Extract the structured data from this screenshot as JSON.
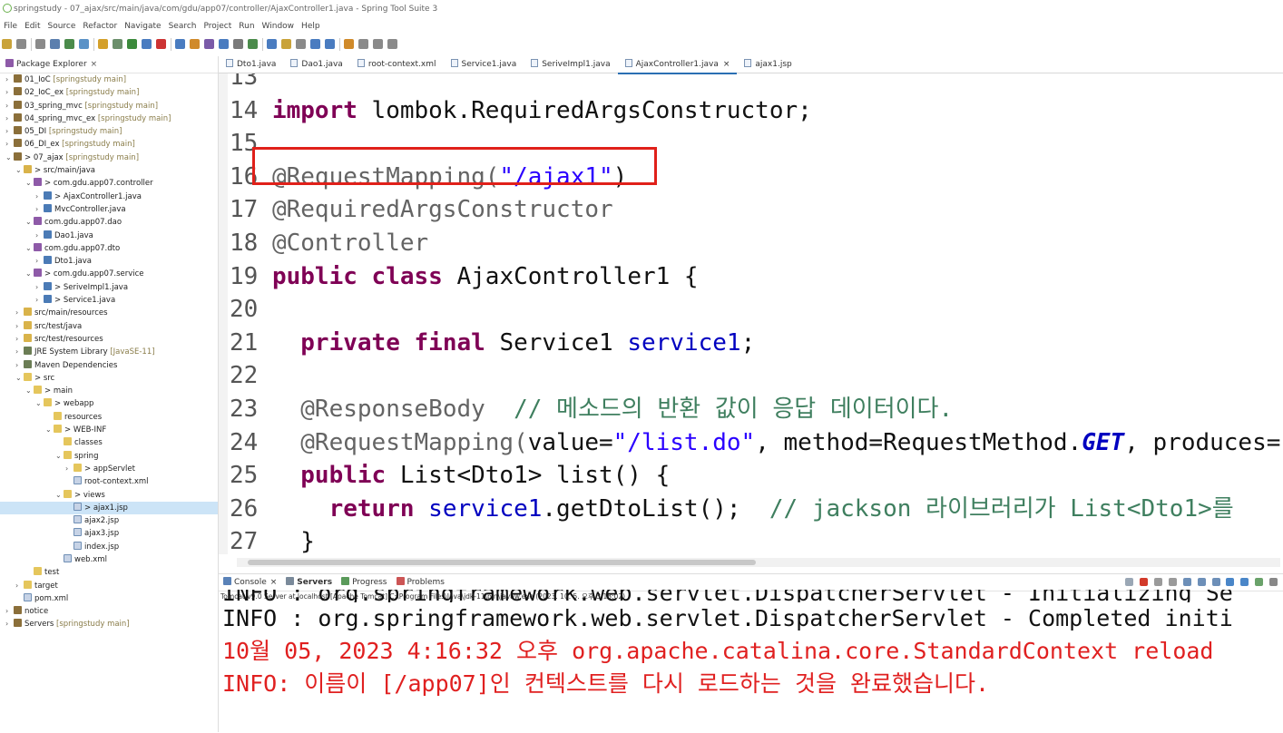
{
  "window": {
    "title": "springstudy - 07_ajax/src/main/java/com/gdu/app07/controller/AjaxController1.java - Spring Tool Suite 3"
  },
  "menu": [
    "File",
    "Edit",
    "Source",
    "Refactor",
    "Navigate",
    "Search",
    "Project",
    "Run",
    "Window",
    "Help"
  ],
  "explorer": {
    "title": "Package Explorer",
    "close": "×",
    "nodes": [
      {
        "label": "01_IoC",
        "deco": " [springstudy main]",
        "arrow": "›",
        "icon": "proj",
        "indent": 0
      },
      {
        "label": "02_IoC_ex",
        "deco": " [springstudy main]",
        "arrow": "›",
        "icon": "proj",
        "indent": 0
      },
      {
        "label": "03_spring_mvc",
        "deco": " [springstudy main]",
        "arrow": "›",
        "icon": "proj",
        "indent": 0
      },
      {
        "label": "04_spring_mvc_ex",
        "deco": " [springstudy main]",
        "arrow": "›",
        "icon": "proj",
        "indent": 0
      },
      {
        "label": "05_DI",
        "deco": " [springstudy main]",
        "arrow": "›",
        "icon": "proj",
        "indent": 0
      },
      {
        "label": "06_DI_ex",
        "deco": " [springstudy main]",
        "arrow": "›",
        "icon": "proj",
        "indent": 0
      },
      {
        "label": "> 07_ajax",
        "deco": " [springstudy main]",
        "arrow": "⌄",
        "icon": "proj",
        "indent": 0
      },
      {
        "label": "> src/main/java",
        "deco": "",
        "arrow": "⌄",
        "icon": "srcf",
        "indent": 1
      },
      {
        "label": "> com.gdu.app07.controller",
        "deco": "",
        "arrow": "⌄",
        "icon": "pkg",
        "indent": 2
      },
      {
        "label": "> AjaxController1.java",
        "deco": "",
        "arrow": "›",
        "icon": "java",
        "indent": 3
      },
      {
        "label": "MvcController.java",
        "deco": "",
        "arrow": "›",
        "icon": "java",
        "indent": 3
      },
      {
        "label": "com.gdu.app07.dao",
        "deco": "",
        "arrow": "⌄",
        "icon": "pkg",
        "indent": 2
      },
      {
        "label": "Dao1.java",
        "deco": "",
        "arrow": "›",
        "icon": "java",
        "indent": 3
      },
      {
        "label": "com.gdu.app07.dto",
        "deco": "",
        "arrow": "⌄",
        "icon": "pkg",
        "indent": 2
      },
      {
        "label": "Dto1.java",
        "deco": "",
        "arrow": "›",
        "icon": "java",
        "indent": 3
      },
      {
        "label": "> com.gdu.app07.service",
        "deco": "",
        "arrow": "⌄",
        "icon": "pkg",
        "indent": 2
      },
      {
        "label": "> SeriveImpl1.java",
        "deco": "",
        "arrow": "›",
        "icon": "java",
        "indent": 3
      },
      {
        "label": "> Service1.java",
        "deco": "",
        "arrow": "›",
        "icon": "java",
        "indent": 3
      },
      {
        "label": "src/main/resources",
        "deco": "",
        "arrow": "›",
        "icon": "srcf",
        "indent": 1
      },
      {
        "label": "src/test/java",
        "deco": "",
        "arrow": "›",
        "icon": "srcf",
        "indent": 1
      },
      {
        "label": "src/test/resources",
        "deco": "",
        "arrow": "›",
        "icon": "srcf",
        "indent": 1
      },
      {
        "label": "JRE System Library",
        "deco": " [JavaSE-11]",
        "arrow": "›",
        "icon": "lib",
        "indent": 1
      },
      {
        "label": "Maven Dependencies",
        "deco": "",
        "arrow": "›",
        "icon": "lib",
        "indent": 1
      },
      {
        "label": "> src",
        "deco": "",
        "arrow": "⌄",
        "icon": "folder",
        "indent": 1
      },
      {
        "label": "> main",
        "deco": "",
        "arrow": "⌄",
        "icon": "folder",
        "indent": 2
      },
      {
        "label": "> webapp",
        "deco": "",
        "arrow": "⌄",
        "icon": "folder",
        "indent": 3
      },
      {
        "label": "resources",
        "deco": "",
        "arrow": "",
        "icon": "folder",
        "indent": 4
      },
      {
        "label": "> WEB-INF",
        "deco": "",
        "arrow": "⌄",
        "icon": "folder",
        "indent": 4
      },
      {
        "label": "classes",
        "deco": "",
        "arrow": "",
        "icon": "folder",
        "indent": 5
      },
      {
        "label": "spring",
        "deco": "",
        "arrow": "⌄",
        "icon": "folder",
        "indent": 5
      },
      {
        "label": "> appServlet",
        "deco": "",
        "arrow": "›",
        "icon": "folder",
        "indent": 6
      },
      {
        "label": "root-context.xml",
        "deco": "",
        "arrow": "",
        "icon": "file",
        "indent": 6
      },
      {
        "label": "> views",
        "deco": "",
        "arrow": "⌄",
        "icon": "folder",
        "indent": 5
      },
      {
        "label": "> ajax1.jsp",
        "deco": "",
        "arrow": "",
        "icon": "file",
        "indent": 6,
        "selected": true
      },
      {
        "label": "ajax2.jsp",
        "deco": "",
        "arrow": "",
        "icon": "file",
        "indent": 6
      },
      {
        "label": "ajax3.jsp",
        "deco": "",
        "arrow": "",
        "icon": "file",
        "indent": 6
      },
      {
        "label": "index.jsp",
        "deco": "",
        "arrow": "",
        "icon": "file",
        "indent": 6
      },
      {
        "label": "web.xml",
        "deco": "",
        "arrow": "",
        "icon": "file",
        "indent": 5
      },
      {
        "label": "test",
        "deco": "",
        "arrow": "",
        "icon": "folder",
        "indent": 2
      },
      {
        "label": "target",
        "deco": "",
        "arrow": "›",
        "icon": "folder",
        "indent": 1
      },
      {
        "label": "pom.xml",
        "deco": "",
        "arrow": "",
        "icon": "file",
        "indent": 1
      },
      {
        "label": "notice",
        "deco": "",
        "arrow": "›",
        "icon": "proj",
        "indent": 0
      },
      {
        "label": "Servers",
        "deco": " [springstudy main]",
        "arrow": "›",
        "icon": "proj",
        "indent": 0
      }
    ]
  },
  "editor": {
    "tabs": [
      {
        "label": "Dto1.java",
        "active": false
      },
      {
        "label": "Dao1.java",
        "active": false
      },
      {
        "label": "root-context.xml",
        "active": false
      },
      {
        "label": "Service1.java",
        "active": false
      },
      {
        "label": "SeriveImpl1.java",
        "active": false
      },
      {
        "label": "AjaxController1.java",
        "active": true
      },
      {
        "label": "ajax1.jsp",
        "active": false
      }
    ],
    "tab_close": "×",
    "lines": [
      {
        "num": "13",
        "parts": []
      },
      {
        "num": "14",
        "parts": [
          {
            "t": "import",
            "c": "kw"
          },
          {
            "t": " lombok.RequiredArgsConstructor;",
            "c": ""
          }
        ]
      },
      {
        "num": "15",
        "parts": []
      },
      {
        "num": "16",
        "parts": [
          {
            "t": "@RequestMapping(",
            "c": "an"
          },
          {
            "t": "\"/ajax1\"",
            "c": "st"
          },
          {
            "t": ")",
            "c": ""
          }
        ]
      },
      {
        "num": "17",
        "parts": [
          {
            "t": "@RequiredArgsConstructor",
            "c": "an"
          }
        ]
      },
      {
        "num": "18",
        "parts": [
          {
            "t": "@Controller",
            "c": "an"
          }
        ]
      },
      {
        "num": "19",
        "parts": [
          {
            "t": "public",
            "c": "kw"
          },
          {
            "t": " ",
            "c": ""
          },
          {
            "t": "class",
            "c": "kw"
          },
          {
            "t": " AjaxController1 {",
            "c": ""
          }
        ]
      },
      {
        "num": "20",
        "parts": []
      },
      {
        "num": "21",
        "parts": [
          {
            "t": "  ",
            "c": ""
          },
          {
            "t": "private",
            "c": "kw"
          },
          {
            "t": " ",
            "c": ""
          },
          {
            "t": "final",
            "c": "kw"
          },
          {
            "t": " Service1 ",
            "c": ""
          },
          {
            "t": "service1",
            "c": "fd"
          },
          {
            "t": ";",
            "c": ""
          }
        ]
      },
      {
        "num": "22",
        "parts": []
      },
      {
        "num": "23",
        "parts": [
          {
            "t": "  ",
            "c": ""
          },
          {
            "t": "@ResponseBody",
            "c": "an"
          },
          {
            "t": "  // 메소드의 반환 값이 응답 데이터이다.",
            "c": "cm"
          }
        ]
      },
      {
        "num": "24",
        "parts": [
          {
            "t": "  ",
            "c": ""
          },
          {
            "t": "@RequestMapping(",
            "c": "an"
          },
          {
            "t": "value=",
            "c": ""
          },
          {
            "t": "\"/list.do\"",
            "c": "st"
          },
          {
            "t": ", method=RequestMethod.",
            "c": ""
          },
          {
            "t": "GET",
            "c": "it"
          },
          {
            "t": ", produces=",
            "c": ""
          }
        ]
      },
      {
        "num": "25",
        "parts": [
          {
            "t": "  ",
            "c": ""
          },
          {
            "t": "public",
            "c": "kw"
          },
          {
            "t": " List<Dto1> list() {",
            "c": ""
          }
        ]
      },
      {
        "num": "26",
        "parts": [
          {
            "t": "    ",
            "c": ""
          },
          {
            "t": "return",
            "c": "kw"
          },
          {
            "t": " ",
            "c": ""
          },
          {
            "t": "service1",
            "c": "fd"
          },
          {
            "t": ".getDtoList();  ",
            "c": ""
          },
          {
            "t": "// jackson 라이브러리가 List<Dto1>를",
            "c": "cm"
          }
        ]
      },
      {
        "num": "27",
        "parts": [
          {
            "t": "  }",
            "c": ""
          }
        ]
      }
    ]
  },
  "console": {
    "tabs": [
      {
        "label": "Console",
        "active": false,
        "close": "×"
      },
      {
        "label": "Servers",
        "active": true
      },
      {
        "label": "Progress",
        "active": false
      },
      {
        "label": "Problems",
        "active": false
      }
    ],
    "description": "Tomcat v9.0 Server at localhost [Apache Tomcat] C:\\Program Files\\Java\\jdk-11\\bin\\javaw.exe  (2023. 10. 5. 오후 3:18:02)",
    "lines": [
      {
        "text": "INFO : org.springframework.web.servlet.DispatcherServlet - Initializing Se",
        "color": "black",
        "cut": true
      },
      {
        "text": "INFO : org.springframework.web.servlet.DispatcherServlet - Completed initi",
        "color": "black"
      },
      {
        "text": "10월 05, 2023 4:16:32 오후 org.apache.catalina.core.StandardContext reload",
        "color": "red"
      },
      {
        "text": "INFO: 이름이 [/app07]인 컨텍스트를 다시 로드하는 것을 완료했습니다.",
        "color": "red"
      }
    ]
  }
}
